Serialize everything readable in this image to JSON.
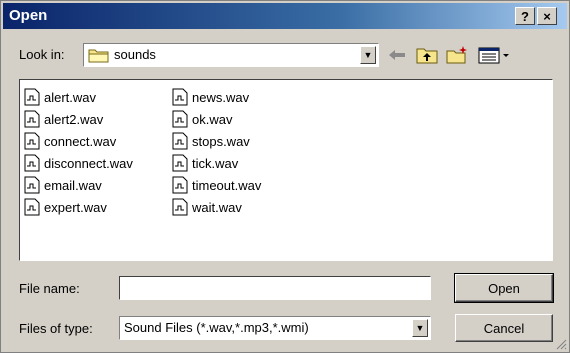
{
  "window": {
    "title": "Open",
    "help_label": "?",
    "close_label": "×"
  },
  "lookin": {
    "label": "Look in:",
    "value": "sounds"
  },
  "toolbar": {
    "icons": [
      "back-arrow-icon",
      "up-folder-icon",
      "new-folder-icon",
      "views-menu-icon"
    ]
  },
  "files": {
    "column1": [
      "alert.wav",
      "alert2.wav",
      "connect.wav",
      "disconnect.wav",
      "email.wav",
      "expert.wav"
    ],
    "column2": [
      "news.wav",
      "ok.wav",
      "stops.wav",
      "tick.wav",
      "timeout.wav",
      "wait.wav"
    ]
  },
  "filename": {
    "label": "File name:",
    "value": ""
  },
  "filetype": {
    "label": "Files of type:",
    "value": "Sound Files (*.wav,*.mp3,*.wmi)"
  },
  "buttons": {
    "open": "Open",
    "cancel": "Cancel"
  },
  "colors": {
    "title_start": "#0a246a",
    "title_end": "#a6caf0",
    "face": "#d4d0c8"
  }
}
